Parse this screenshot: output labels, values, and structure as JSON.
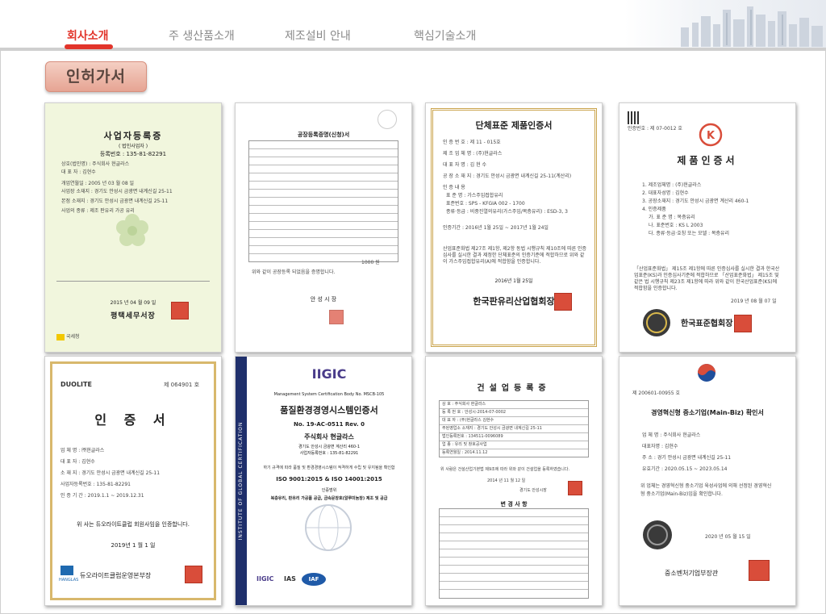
{
  "nav": {
    "items": [
      {
        "label": "회사소개",
        "active": true
      },
      {
        "label": "주 생산품소개",
        "active": false
      },
      {
        "label": "제조설비 안내",
        "active": false
      },
      {
        "label": "핵심기술소개",
        "active": false
      }
    ]
  },
  "section": {
    "title": "인허가서"
  },
  "colors": {
    "accent": "#e2342a",
    "tag_bg": "#e6a493"
  },
  "certificates": [
    {
      "title": "사업자등록증",
      "subtitle": "( 법인사업자 )",
      "number": "등록번호 : 135-81-82291",
      "lines": [
        "상호(법인명) : 주식회사 현글라스",
        "대 표 자 : 김현수",
        "개업연월일 : 2005 년 03 월 08 일",
        "사업장 소재지 : 경기도 안성시 금광면 내계신길 25-11",
        "본점 소재지 : 경기도 안성시 금광면 내계신길 25-11",
        "사업의 종류 : 제조 판유리 가공 유리"
      ],
      "date": "2015 년 04 월 09 일",
      "issuer": "평택세무서장",
      "footer": "국세청"
    },
    {
      "title": "공장등록증명(신청)서",
      "note": "위와 같이 공장등록 되었음을 증명합니다.",
      "issuer": "안 성 시 장",
      "amount": "1000 원"
    },
    {
      "title": "단체표준 제품인증서",
      "lines": [
        "인 증 번 호 : 제 11 - 015호",
        "제 조 업 체 명 : (주)현글라스",
        "대 표 자 명 : 김 현 수",
        "공 장 소 재 지 : 경기도 안성시 금광면 내계신길 25-11(계산리)",
        "인 증 내 용",
        "표 준 명 : 가스주입접합유리",
        "표준번호 : SPS - KFGIA 002 - 1700",
        "종류·등급 : 비중진열의유리(가스주입/복층유리) : ESD-3, 3",
        "인증기간 : 2016년 1월 25일 ~ 2017년 1월 24일"
      ],
      "body": "산업표준화법 제27조 제1항, 제2항 동법 시행규칙 제10조에 따른 인증심사를 실시한 결과 제정한 단체표준의 인증기준에 적합하므로 위와 같이 가스주입접합유리(A)에 적합함을 인증합니다.",
      "date": "2016년 1월 25일",
      "issuer": "한국판유리산업협회장"
    },
    {
      "top": "인증번호 : 제 07-0012 호",
      "title": "제품인증서",
      "lines": [
        "1. 제조업체명 : (주)현글라스",
        "2. 대표자성명 : 김현수",
        "3. 공장소재지 : 경기도 안성시 금광면 계산리 460-1",
        "4. 인증제품",
        "가. 표 준 명 : 복층유리",
        "나. 표준번호 : KS L 2003",
        "다. 종류·등급·호칭 또는 모델 : 복층유리"
      ],
      "body": "「산업표준화법」 제15조 제1항에 따른 인증심사를 실시한 결과 한국산업표준(KS)과 인증심사기준에 적합하므로 「산업표준화법」 제15조 및 같은 법 시행규칙 제23조 제1항에 따라 위와 같이 한국산업표준(KS)에 적합함을 인증합니다.",
      "date": "2019 년 08 월 07 일",
      "issuer": "한국표준협회장"
    },
    {
      "brand": "DUOLITE",
      "number": "제 064901 호",
      "title": "인 증 서",
      "lines": [
        "업 체 명 : ㈜현글라스",
        "대 표 자 : 김현수",
        "소 재 지 : 경기도 안성시 금광면 내계신길 25-11",
        "사업자등록번호 : 135-81-82291",
        "인 증 기 간 : 2019.1.1 ~ 2019.12.31"
      ],
      "body": "위 사는 듀오라이트클럽 회원사임을 인증합니다.",
      "date": "2019년 1 월 1 일",
      "logo": "HANGLAS",
      "issuer": "듀오라이트클럽운영본부장"
    },
    {
      "brand": "IIGIC",
      "header": "Management System Certification Body No. MSCB-105",
      "title": "품질환경경영시스템인증서",
      "number": "No. 19-AC-0511 Rev. 0",
      "company": "주식회사 현글라스",
      "lines": [
        "경기도 안성시 금광면 계산리 460-1",
        "사업자등록번호 : 135-81-82291"
      ],
      "std_intro": "하기 규격에 따라 품질 및 환경경영시스템이 적격하게 수립 및 유지됨을 확인함",
      "standard": "ISO 9001:2015 & ISO 14001:2015",
      "scope_label": "인증범위",
      "scope": "복층유리, 판유리 가공품 공급, 금속문창호(알루미늄창) 제조 및 공급",
      "side": "INSTITUTE OF GLOBAL CERTIFICATION",
      "logos": [
        "IIGIC",
        "IAS",
        "IAF"
      ]
    },
    {
      "title": "건설업등록증",
      "lines": [
        "상 호 : 주식회사 현글라스",
        "등 록 번 호 : 안성시-2014-07-0002",
        "대 표 자 : (주)현글라스 김현수",
        "주된영업소 소재지 : 경기도 안성시 금광면 내계신길 25-11",
        "법인등록번호 : 134511-0096089",
        "업 종 : 유리 및 창호공사업",
        "등록연월일 : 2014.11.12"
      ],
      "body": "위 사람은 건설산업기본법 제9조에 따라 위와 같이 건설업을 등록하였습니다.",
      "date": "2014 년 11 월 12 일",
      "issuer": "경기도 안성시장",
      "table_title": "변 경 사 항"
    },
    {
      "number": "제 200601-00955 호",
      "title": "경영혁신형 중소기업(Main-Biz) 확인서",
      "lines": [
        "업 체 명 : 주식회사 현글라스",
        "대표자명 : 김현수",
        "주 소 : 경기 안성시 금광면 내계신길 25-11",
        "유효기간 : 2020.05.15 ~ 2023.05.14"
      ],
      "body": "위 업체는 경영혁신형 중소기업 육성사업에 의해 선정된 경영혁신형 중소기업(Main-Biz)임을 확인합니다.",
      "date": "2020 년 05 월 15 일",
      "issuer": "중소벤처기업부장관"
    }
  ]
}
